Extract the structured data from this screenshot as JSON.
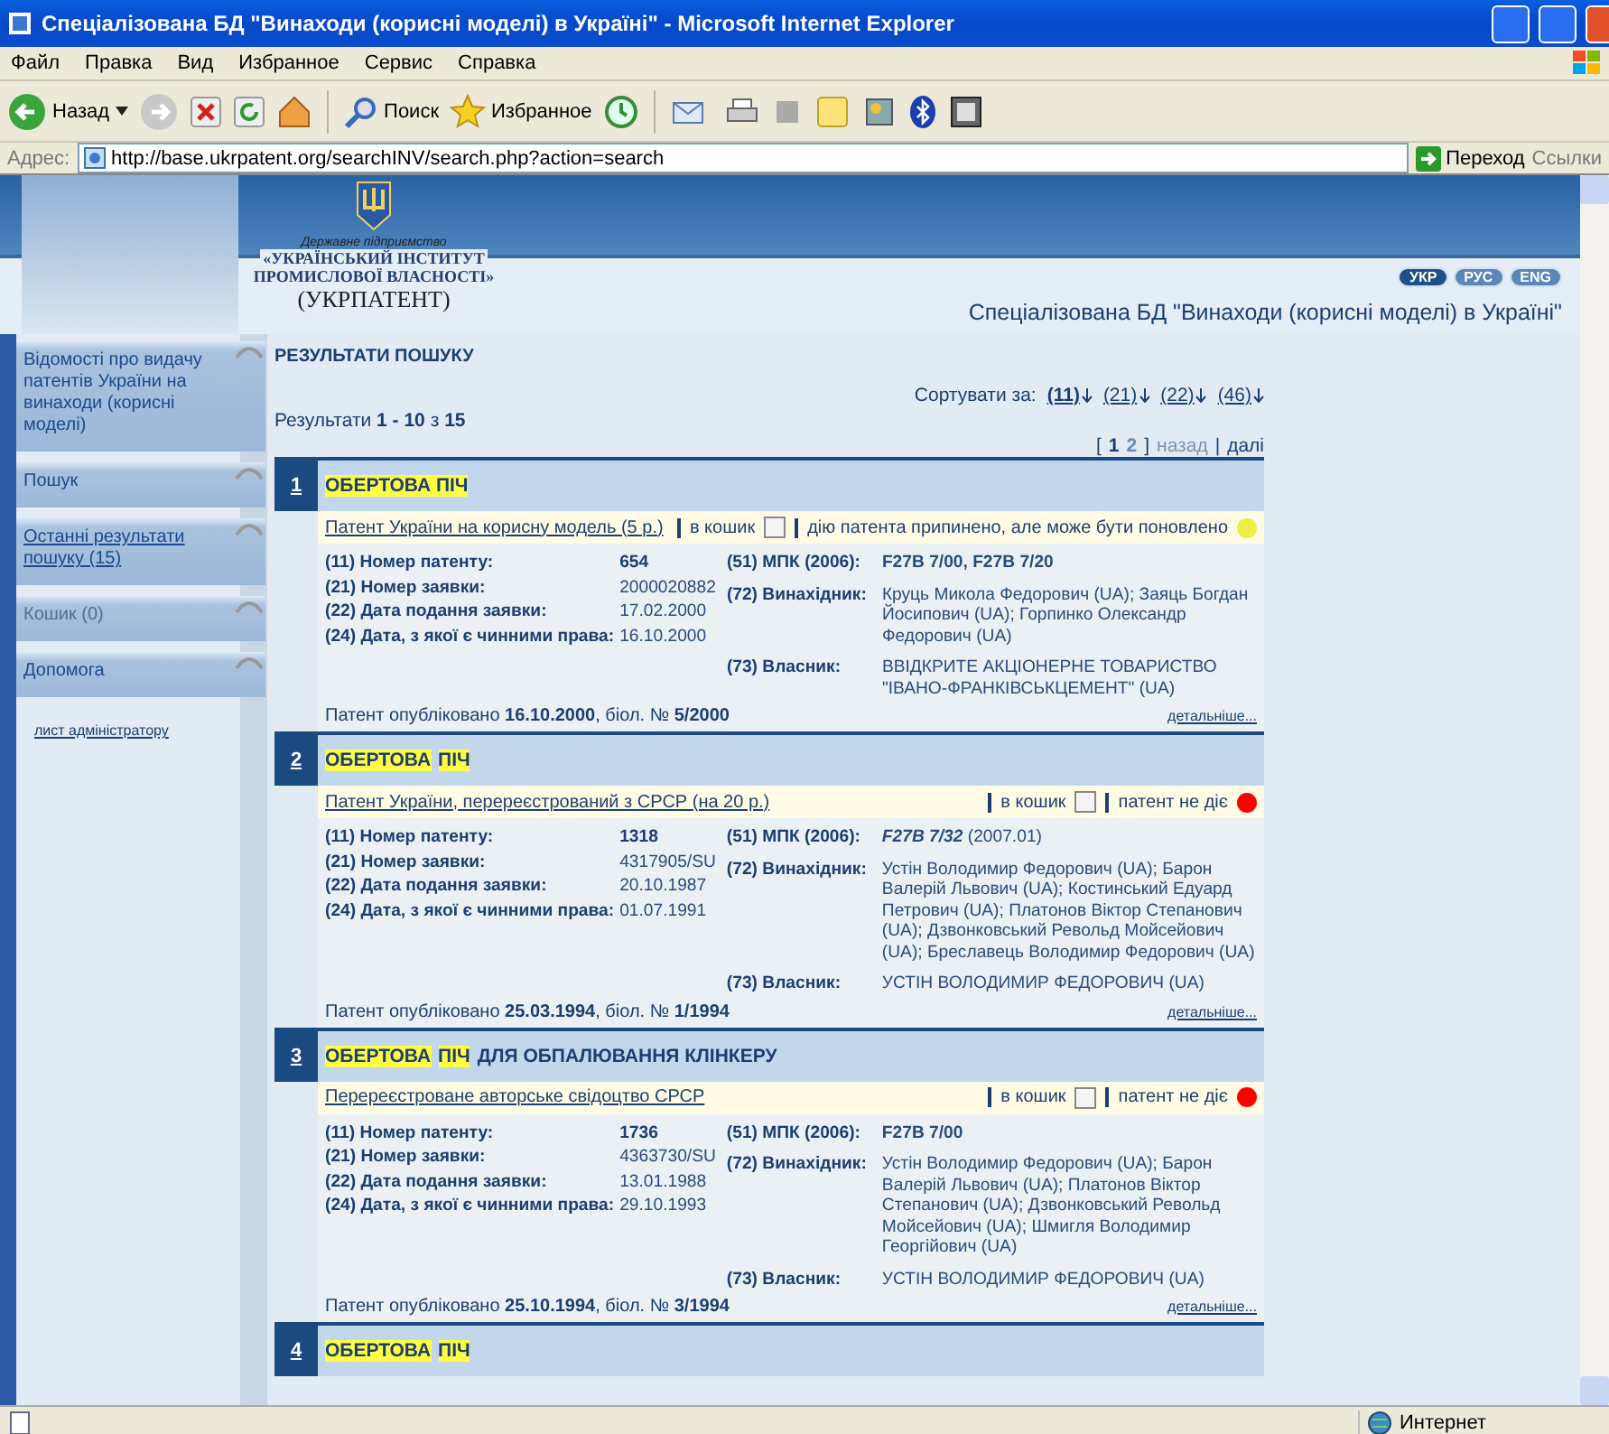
{
  "window": {
    "title": "Спеціалізована БД \"Винаходи (корисні моделі) в Україні\" - Microsoft Internet Explorer"
  },
  "menu": [
    "Файл",
    "Правка",
    "Вид",
    "Избранное",
    "Сервис",
    "Справка"
  ],
  "toolbar": {
    "back": "Назад",
    "search": "Поиск",
    "favorites": "Избранное"
  },
  "address_bar": {
    "label": "Адрес:",
    "url": "http://base.ukrpatent.org/searchINV/search.php?action=search",
    "go": "Переход",
    "links": "Ссылки"
  },
  "header": {
    "logo_caption": "Державне підприємство",
    "logo_name": "«УКРАЇНСЬКИЙ ІНСТИТУТ",
    "logo_name_2": "ПРОМИСЛОВОЇ ВЛАСНОСТІ»",
    "logo_abbr": "(УКРПАТЕНТ)",
    "languages": [
      {
        "label": "УКР",
        "selected": true
      },
      {
        "label": "РУС",
        "selected": false
      },
      {
        "label": "ENG",
        "selected": false
      }
    ],
    "title": "Спеціалізована БД \"Винаходи (корисні моделі) в Україні\""
  },
  "sidebar": {
    "items": [
      {
        "label": "Відомості про видачу патентів України на винаходи (корисні моделі)",
        "kind": "plain",
        "disabled": false
      },
      {
        "label": "Пошук",
        "kind": "plain",
        "disabled": false
      },
      {
        "label": "Останні результати пошуку (15)",
        "kind": "link",
        "disabled": false
      },
      {
        "label": "Кошик (0)",
        "kind": "plain",
        "disabled": true
      },
      {
        "label": "Допомога",
        "kind": "plain",
        "disabled": false
      }
    ],
    "admin_link": "лист адміністратору"
  },
  "results": {
    "heading": "РЕЗУЛЬТАТИ ПОШУКУ",
    "sort_label": "Сортувати за:",
    "sort_options": [
      {
        "label": "(11)",
        "selected": true
      },
      {
        "label": "(21)",
        "selected": false
      },
      {
        "label": "(22)",
        "selected": false
      },
      {
        "label": "(46)",
        "selected": false
      }
    ],
    "summary": "Результати **1 - 10** з **15**",
    "pagination": {
      "open": "[",
      "pages": [
        {
          "label": "1",
          "selected": true
        },
        {
          "label": "2",
          "selected": false
        }
      ],
      "close": "]",
      "prev": {
        "label": "назад",
        "disabled": true
      },
      "separator": "|",
      "next": {
        "label": "далі",
        "disabled": false
      }
    },
    "items": [
      {
        "number": "1",
        "title": [
          {
            "text": "ОБЕРТОВА ПІЧ",
            "highlighted": true
          }
        ],
        "type": "Патент України на корисну модель (5 р.)",
        "cart_label": "в кошик",
        "in_cart": false,
        "status": "дію патента припинено, але може бути поновлено",
        "color": "#eeee44",
        "fields": [
          {
            "label": "(11) Номер патенту:",
            "value": "654"
          },
          {
            "label": "(21) Номер заявки:",
            "value": "2000020882"
          },
          {
            "label": "(22) Дата подання заявки:",
            "value": "17.02.2000"
          },
          {
            "label": "(24) Дата, з якої є чинними права:",
            "value": "16.10.2000"
          }
        ],
        "ipc": {
          "label": "(51) МПК (2006):",
          "code": "F27B 7/00, F27B 7/20",
          "italic": false
        },
        "inventors": {
          "label": "(72) Винахідник:",
          "value": "Круць Микола Федорович (UA); Заяць Богдан Йосипович (UA); Горпинко Олександр Федорович (UA)"
        },
        "owner": {
          "label": "(73) Власник:",
          "value": "ВВІДКРИТЕ АКЦІОНЕРНЕ ТОВАРИСТВО \"ІВАНО-ФРАНКІВСЬКЦЕМЕНТ\" (UA)"
        },
        "published": "Патент опубліковано **16.10.2000**, біол. № **5/2000**",
        "details_link": "детальніше..."
      },
      {
        "number": "2",
        "title": [
          {
            "text": "ОБЕРТОВА",
            "highlighted": true
          },
          {
            "text": "ПІЧ",
            "highlighted": true
          }
        ],
        "type": "Патент України, перереєстрований з СРСР (на 20 р.)",
        "cart_label": "в кошик",
        "in_cart": false,
        "status": "патент не діє",
        "color": "#ff0000",
        "fields": [
          {
            "label": "(11) Номер патенту:",
            "value": "1318"
          },
          {
            "label": "(21) Номер заявки:",
            "value": "4317905/SU"
          },
          {
            "label": "(22) Дата подання заявки:",
            "value": "20.10.1987"
          },
          {
            "label": "(24) Дата, з якої є чинними права:",
            "value": "01.07.1991"
          }
        ],
        "ipc": {
          "label": "(51) МПК (2006):",
          "code": "F27B 7/32",
          "edition": "(2007.01)",
          "italic": true
        },
        "inventors": {
          "label": "(72) Винахідник:",
          "value": "Устін Володимир Федорович (UA); Барон Валерій Львович (UA); Костинський Едуард Петрович (UA); Платонов Віктор Степанович (UA); Дзвонковський Револьд Мойсейович (UA); Бреславець Володимир Федорович (UA)"
        },
        "owner": {
          "label": "(73) Власник:",
          "value": "УСТІН ВОЛОДИМИР ФЕДОРОВИЧ (UA)"
        },
        "published": "Патент опубліковано **25.03.1994**, біол. № **1/1994**",
        "details_link": "детальніше..."
      },
      {
        "number": "3",
        "title": [
          {
            "text": "ОБЕРТОВА",
            "highlighted": true
          },
          {
            "text": "ПІЧ",
            "highlighted": true
          },
          {
            "text": "ДЛЯ ОБПАЛЮВАННЯ КЛІНКЕРУ",
            "highlighted": false
          }
        ],
        "type": "Перереєстроване авторське свідоцтво СРСР",
        "cart_label": "в кошик",
        "in_cart": false,
        "status": "патент не діє",
        "color": "#ff0000",
        "fields": [
          {
            "label": "(11) Номер патенту:",
            "value": "1736"
          },
          {
            "label": "(21) Номер заявки:",
            "value": "4363730/SU"
          },
          {
            "label": "(22) Дата подання заявки:",
            "value": "13.01.1988"
          },
          {
            "label": "(24) Дата, з якої є чинними права:",
            "value": "29.10.1993"
          }
        ],
        "ipc": {
          "label": "(51) МПК (2006):",
          "code": "F27B 7/00",
          "italic": false
        },
        "inventors": {
          "label": "(72) Винахідник:",
          "value": "Устін Володимир Федорович (UA); Барон Валерій Львович (UA); Платонов Віктор Степанович (UA); Дзвонковський Револьд Мойсейович (UA); Шмигля Володимир Георгійович (UA)"
        },
        "owner": {
          "label": "(73) Власник:",
          "value": "УСТІН ВОЛОДИМИР ФЕДОРОВИЧ (UA)"
        },
        "published": "Патент опубліковано **25.10.1994**, біол. № **3/1994**",
        "details_link": "детальніше..."
      },
      {
        "number": "4",
        "title": [
          {
            "text": "ОБЕРТОВА",
            "highlighted": true
          },
          {
            "text": "ПІЧ",
            "highlighted": true
          }
        ]
      }
    ]
  },
  "status_bar": {
    "zone": "Интернет"
  }
}
